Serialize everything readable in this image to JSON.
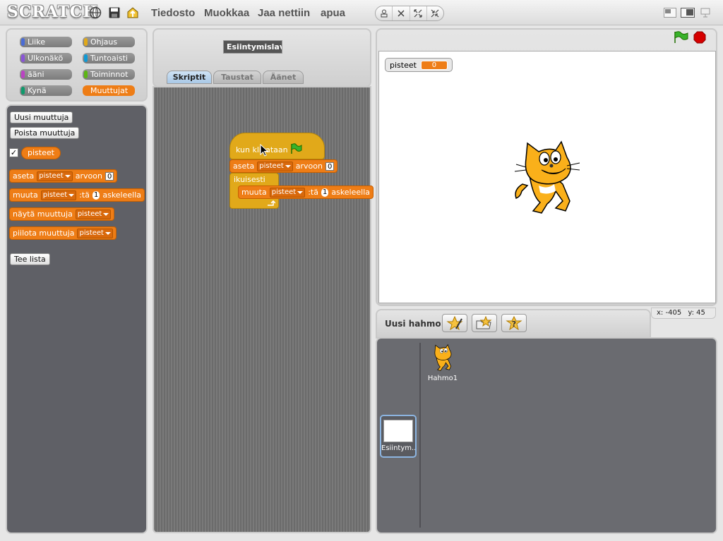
{
  "app": {
    "logo": "SCRATCH"
  },
  "menu": {
    "items": [
      "Tiedosto",
      "Muokkaa",
      "Jaa nettiin",
      "apua"
    ]
  },
  "categories": [
    {
      "label": "Liike",
      "color": "#4a6cd4"
    },
    {
      "label": "Ohjaus",
      "color": "#e1a91a"
    },
    {
      "label": "Ulkonäkö",
      "color": "#8a55d7"
    },
    {
      "label": "Tuntoaisti",
      "color": "#0e9ad7"
    },
    {
      "label": "ääni",
      "color": "#bb42c3"
    },
    {
      "label": "Toiminnot",
      "color": "#5cb712"
    },
    {
      "label": "Kynä",
      "color": "#0e9a6c"
    },
    {
      "label": "Muuttujat",
      "color": "#ee7d16",
      "selected": true
    }
  ],
  "palette": {
    "new_var": "Uusi muuttuja",
    "delete_var": "Poista muuttuja",
    "var_name": "pisteet",
    "var_checked": true,
    "set_block": {
      "label": "aseta",
      "dropdown": "pisteet",
      "suffix": "arvoon",
      "value": "0"
    },
    "change_block": {
      "label": "muuta",
      "dropdown": "pisteet",
      "suffix1": ":tä",
      "value": "1",
      "suffix2": "askeleella"
    },
    "show_block": {
      "label": "näytä muuttuja",
      "dropdown": "pisteet"
    },
    "hide_block": {
      "label": "piilota muuttuja",
      "dropdown": "pisteet"
    },
    "make_list": "Tee lista"
  },
  "sprite_info": {
    "name": "Esiintymislava"
  },
  "tabs": [
    {
      "label": "Skriptit",
      "active": true
    },
    {
      "label": "Taustat"
    },
    {
      "label": "Äänet"
    }
  ],
  "script": {
    "hat": "kun klikataan",
    "set": {
      "label": "aseta",
      "dropdown": "pisteet",
      "suffix": "arvoon",
      "value": "0"
    },
    "forever": "ikuisesti",
    "change": {
      "label": "muuta",
      "dropdown": "pisteet",
      "suffix1": ":tä",
      "value": "1",
      "suffix2": "askeleella"
    }
  },
  "stage": {
    "monitor": {
      "label": "pisteet",
      "value": "0"
    }
  },
  "coords": {
    "x_label": "x:",
    "x": "-405",
    "y_label": "y:",
    "y": "45"
  },
  "sprites_bar": {
    "label": "Uusi hahmo:"
  },
  "sprites": [
    {
      "name": "Hahmo1"
    }
  ],
  "stage_thumb": {
    "name": "Esiintym.."
  }
}
